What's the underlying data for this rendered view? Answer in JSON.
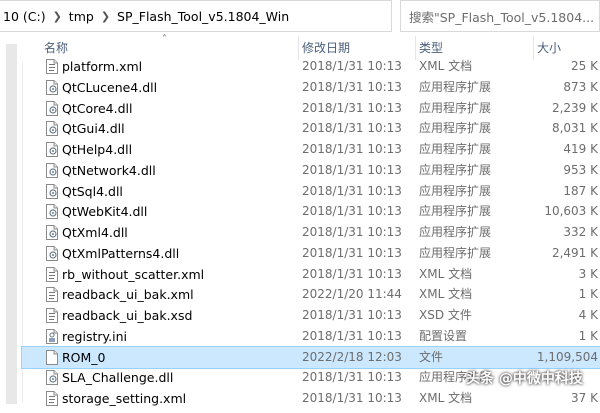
{
  "address": {
    "crumbs": [
      "10 (C:)",
      "tmp",
      "SP_Flash_Tool_v5.1804_Win"
    ],
    "search_placeholder": "搜索\"SP_Flash_Tool_v5.1804..."
  },
  "columns": {
    "name": "名称",
    "date": "修改日期",
    "type": "类型",
    "size": "大小"
  },
  "files": [
    {
      "name": "platform.xml",
      "date": "2018/1/31 10:13",
      "type": "XML 文档",
      "size": "25 K",
      "icon": "xml-file-icon"
    },
    {
      "name": "QtCLucene4.dll",
      "date": "2018/1/31 10:13",
      "type": "应用程序扩展",
      "size": "873 K",
      "icon": "dll-file-icon"
    },
    {
      "name": "QtCore4.dll",
      "date": "2018/1/31 10:13",
      "type": "应用程序扩展",
      "size": "2,239 K",
      "icon": "dll-file-icon"
    },
    {
      "name": "QtGui4.dll",
      "date": "2018/1/31 10:13",
      "type": "应用程序扩展",
      "size": "8,031 K",
      "icon": "dll-file-icon"
    },
    {
      "name": "QtHelp4.dll",
      "date": "2018/1/31 10:13",
      "type": "应用程序扩展",
      "size": "419 K",
      "icon": "dll-file-icon"
    },
    {
      "name": "QtNetwork4.dll",
      "date": "2018/1/31 10:13",
      "type": "应用程序扩展",
      "size": "953 K",
      "icon": "dll-file-icon"
    },
    {
      "name": "QtSql4.dll",
      "date": "2018/1/31 10:13",
      "type": "应用程序扩展",
      "size": "187 K",
      "icon": "dll-file-icon"
    },
    {
      "name": "QtWebKit4.dll",
      "date": "2018/1/31 10:13",
      "type": "应用程序扩展",
      "size": "10,603 K",
      "icon": "dll-file-icon"
    },
    {
      "name": "QtXml4.dll",
      "date": "2018/1/31 10:13",
      "type": "应用程序扩展",
      "size": "332 K",
      "icon": "dll-file-icon"
    },
    {
      "name": "QtXmlPatterns4.dll",
      "date": "2018/1/31 10:13",
      "type": "应用程序扩展",
      "size": "2,491 K",
      "icon": "dll-file-icon"
    },
    {
      "name": "rb_without_scatter.xml",
      "date": "2018/1/31 10:13",
      "type": "XML 文档",
      "size": "3 K",
      "icon": "xml-file-icon"
    },
    {
      "name": "readback_ui_bak.xml",
      "date": "2022/1/20 11:44",
      "type": "XML 文档",
      "size": "1 K",
      "icon": "xml-file-icon"
    },
    {
      "name": "readback_ui_bak.xsd",
      "date": "2018/1/31 10:13",
      "type": "XSD 文件",
      "size": "4 K",
      "icon": "xsd-file-icon"
    },
    {
      "name": "registry.ini",
      "date": "2018/1/31 10:13",
      "type": "配置设置",
      "size": "1 K",
      "icon": "ini-file-icon"
    },
    {
      "name": "ROM_0",
      "date": "2022/2/18 12:03",
      "type": "文件",
      "size": "1,109,504",
      "icon": "blank-file-icon",
      "selected": true
    },
    {
      "name": "SLA_Challenge.dll",
      "date": "2018/1/31 10:13",
      "type": "应用程序扩展",
      "size": "",
      "icon": "dll-file-icon"
    },
    {
      "name": "storage_setting.xml",
      "date": "2018/1/31 10:13",
      "type": "XML 文档",
      "size": "37 K",
      "icon": "xml-file-icon"
    }
  ],
  "watermark": "头条 @中微中科技"
}
